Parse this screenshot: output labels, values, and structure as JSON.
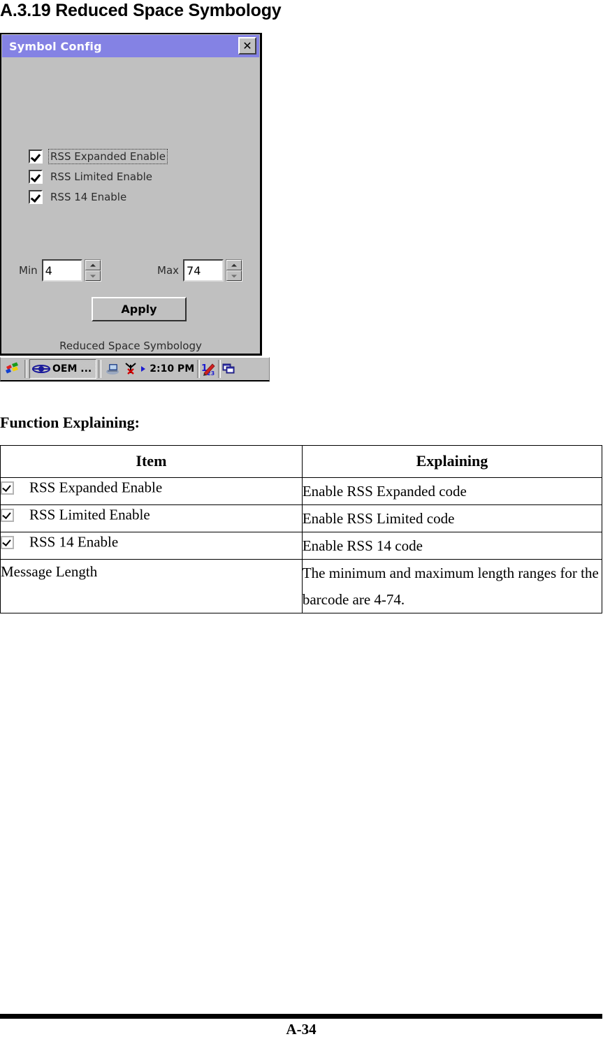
{
  "heading": "A.3.19 Reduced Space Symbology",
  "device_screenshot": {
    "window": {
      "title": "Symbol Config",
      "titlebar_color": "#8482e4",
      "close_button_label": "✕",
      "checkboxes": [
        {
          "label": "RSS Expanded Enable",
          "checked": true,
          "focused": true
        },
        {
          "label": "RSS Limited Enable",
          "checked": true,
          "focused": false
        },
        {
          "label": "RSS 14 Enable",
          "checked": true,
          "focused": false
        }
      ],
      "range": {
        "min_label": "Min",
        "min_value": "4",
        "max_label": "Max",
        "max_value": "74"
      },
      "apply_label": "Apply",
      "caption": "Reduced Space Symbology"
    },
    "taskbar": {
      "start_icon": "windows-flag-icon",
      "task_button": {
        "icon": "oem-eye-icon",
        "label": "OEM ..."
      },
      "tray": {
        "desktop_icon": "desktop-pc-icon",
        "connection_icon": "no-connection-icon",
        "arrow_icon": "tray-arrow-icon",
        "clock": "2:10 PM",
        "input_panel_icon": "pen-input-panel-icon",
        "window_switch_icon": "window-switcher-icon"
      }
    }
  },
  "section_label": "Function Explaining:",
  "table": {
    "headers": [
      "Item",
      "Explaining"
    ],
    "rows": [
      {
        "checkbox": true,
        "item": "RSS Expanded Enable",
        "explain": "Enable RSS Expanded code"
      },
      {
        "checkbox": true,
        "item": "RSS Limited Enable",
        "explain": "Enable RSS Limited code"
      },
      {
        "checkbox": true,
        "item": "RSS 14 Enable",
        "explain": "Enable RSS 14 code"
      },
      {
        "checkbox": false,
        "item": "Message Length",
        "explain": "The minimum and maximum length ranges for the barcode are 4-74."
      }
    ]
  },
  "footer": {
    "page_number": "A-34"
  }
}
